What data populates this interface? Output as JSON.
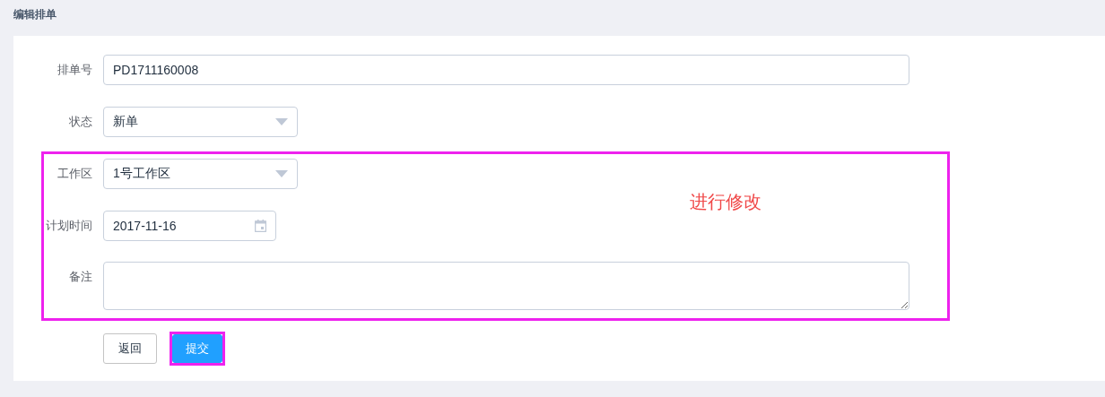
{
  "page_title": "编辑排单",
  "fields": [
    {
      "kind": "text",
      "label": "排单号",
      "value": "PD1711160008"
    },
    {
      "kind": "select",
      "label": "状态",
      "value": "新单"
    },
    {
      "kind": "select",
      "label": "工作区",
      "value": "1号工作区"
    },
    {
      "kind": "date",
      "label": "计划时间",
      "value": "2017-11-16"
    },
    {
      "kind": "textarea",
      "label": "备注"
    }
  ],
  "buttons": [
    {
      "kind": "default",
      "label": "返回"
    },
    {
      "kind": "primary",
      "label": "提交"
    }
  ],
  "annotation": "进行修改"
}
